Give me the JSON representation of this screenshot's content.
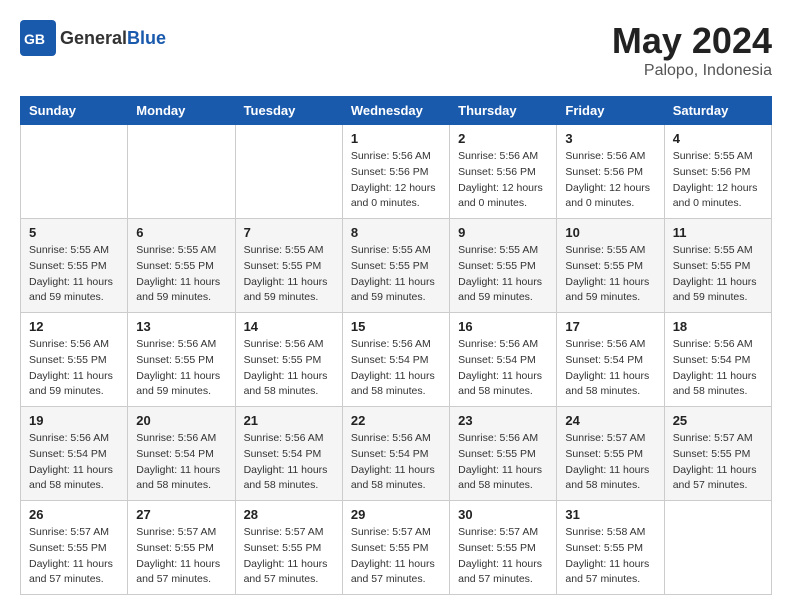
{
  "logo": {
    "text_general": "General",
    "text_blue": "Blue"
  },
  "title": "May 2024",
  "subtitle": "Palopo, Indonesia",
  "days_of_week": [
    "Sunday",
    "Monday",
    "Tuesday",
    "Wednesday",
    "Thursday",
    "Friday",
    "Saturday"
  ],
  "weeks": [
    [
      {
        "day": "",
        "sunrise": "",
        "sunset": "",
        "daylight": ""
      },
      {
        "day": "",
        "sunrise": "",
        "sunset": "",
        "daylight": ""
      },
      {
        "day": "",
        "sunrise": "",
        "sunset": "",
        "daylight": ""
      },
      {
        "day": "1",
        "sunrise": "Sunrise: 5:56 AM",
        "sunset": "Sunset: 5:56 PM",
        "daylight": "Daylight: 12 hours and 0 minutes."
      },
      {
        "day": "2",
        "sunrise": "Sunrise: 5:56 AM",
        "sunset": "Sunset: 5:56 PM",
        "daylight": "Daylight: 12 hours and 0 minutes."
      },
      {
        "day": "3",
        "sunrise": "Sunrise: 5:56 AM",
        "sunset": "Sunset: 5:56 PM",
        "daylight": "Daylight: 12 hours and 0 minutes."
      },
      {
        "day": "4",
        "sunrise": "Sunrise: 5:55 AM",
        "sunset": "Sunset: 5:56 PM",
        "daylight": "Daylight: 12 hours and 0 minutes."
      }
    ],
    [
      {
        "day": "5",
        "sunrise": "Sunrise: 5:55 AM",
        "sunset": "Sunset: 5:55 PM",
        "daylight": "Daylight: 11 hours and 59 minutes."
      },
      {
        "day": "6",
        "sunrise": "Sunrise: 5:55 AM",
        "sunset": "Sunset: 5:55 PM",
        "daylight": "Daylight: 11 hours and 59 minutes."
      },
      {
        "day": "7",
        "sunrise": "Sunrise: 5:55 AM",
        "sunset": "Sunset: 5:55 PM",
        "daylight": "Daylight: 11 hours and 59 minutes."
      },
      {
        "day": "8",
        "sunrise": "Sunrise: 5:55 AM",
        "sunset": "Sunset: 5:55 PM",
        "daylight": "Daylight: 11 hours and 59 minutes."
      },
      {
        "day": "9",
        "sunrise": "Sunrise: 5:55 AM",
        "sunset": "Sunset: 5:55 PM",
        "daylight": "Daylight: 11 hours and 59 minutes."
      },
      {
        "day": "10",
        "sunrise": "Sunrise: 5:55 AM",
        "sunset": "Sunset: 5:55 PM",
        "daylight": "Daylight: 11 hours and 59 minutes."
      },
      {
        "day": "11",
        "sunrise": "Sunrise: 5:55 AM",
        "sunset": "Sunset: 5:55 PM",
        "daylight": "Daylight: 11 hours and 59 minutes."
      }
    ],
    [
      {
        "day": "12",
        "sunrise": "Sunrise: 5:56 AM",
        "sunset": "Sunset: 5:55 PM",
        "daylight": "Daylight: 11 hours and 59 minutes."
      },
      {
        "day": "13",
        "sunrise": "Sunrise: 5:56 AM",
        "sunset": "Sunset: 5:55 PM",
        "daylight": "Daylight: 11 hours and 59 minutes."
      },
      {
        "day": "14",
        "sunrise": "Sunrise: 5:56 AM",
        "sunset": "Sunset: 5:55 PM",
        "daylight": "Daylight: 11 hours and 58 minutes."
      },
      {
        "day": "15",
        "sunrise": "Sunrise: 5:56 AM",
        "sunset": "Sunset: 5:54 PM",
        "daylight": "Daylight: 11 hours and 58 minutes."
      },
      {
        "day": "16",
        "sunrise": "Sunrise: 5:56 AM",
        "sunset": "Sunset: 5:54 PM",
        "daylight": "Daylight: 11 hours and 58 minutes."
      },
      {
        "day": "17",
        "sunrise": "Sunrise: 5:56 AM",
        "sunset": "Sunset: 5:54 PM",
        "daylight": "Daylight: 11 hours and 58 minutes."
      },
      {
        "day": "18",
        "sunrise": "Sunrise: 5:56 AM",
        "sunset": "Sunset: 5:54 PM",
        "daylight": "Daylight: 11 hours and 58 minutes."
      }
    ],
    [
      {
        "day": "19",
        "sunrise": "Sunrise: 5:56 AM",
        "sunset": "Sunset: 5:54 PM",
        "daylight": "Daylight: 11 hours and 58 minutes."
      },
      {
        "day": "20",
        "sunrise": "Sunrise: 5:56 AM",
        "sunset": "Sunset: 5:54 PM",
        "daylight": "Daylight: 11 hours and 58 minutes."
      },
      {
        "day": "21",
        "sunrise": "Sunrise: 5:56 AM",
        "sunset": "Sunset: 5:54 PM",
        "daylight": "Daylight: 11 hours and 58 minutes."
      },
      {
        "day": "22",
        "sunrise": "Sunrise: 5:56 AM",
        "sunset": "Sunset: 5:54 PM",
        "daylight": "Daylight: 11 hours and 58 minutes."
      },
      {
        "day": "23",
        "sunrise": "Sunrise: 5:56 AM",
        "sunset": "Sunset: 5:55 PM",
        "daylight": "Daylight: 11 hours and 58 minutes."
      },
      {
        "day": "24",
        "sunrise": "Sunrise: 5:57 AM",
        "sunset": "Sunset: 5:55 PM",
        "daylight": "Daylight: 11 hours and 58 minutes."
      },
      {
        "day": "25",
        "sunrise": "Sunrise: 5:57 AM",
        "sunset": "Sunset: 5:55 PM",
        "daylight": "Daylight: 11 hours and 57 minutes."
      }
    ],
    [
      {
        "day": "26",
        "sunrise": "Sunrise: 5:57 AM",
        "sunset": "Sunset: 5:55 PM",
        "daylight": "Daylight: 11 hours and 57 minutes."
      },
      {
        "day": "27",
        "sunrise": "Sunrise: 5:57 AM",
        "sunset": "Sunset: 5:55 PM",
        "daylight": "Daylight: 11 hours and 57 minutes."
      },
      {
        "day": "28",
        "sunrise": "Sunrise: 5:57 AM",
        "sunset": "Sunset: 5:55 PM",
        "daylight": "Daylight: 11 hours and 57 minutes."
      },
      {
        "day": "29",
        "sunrise": "Sunrise: 5:57 AM",
        "sunset": "Sunset: 5:55 PM",
        "daylight": "Daylight: 11 hours and 57 minutes."
      },
      {
        "day": "30",
        "sunrise": "Sunrise: 5:57 AM",
        "sunset": "Sunset: 5:55 PM",
        "daylight": "Daylight: 11 hours and 57 minutes."
      },
      {
        "day": "31",
        "sunrise": "Sunrise: 5:58 AM",
        "sunset": "Sunset: 5:55 PM",
        "daylight": "Daylight: 11 hours and 57 minutes."
      },
      {
        "day": "",
        "sunrise": "",
        "sunset": "",
        "daylight": ""
      }
    ]
  ]
}
